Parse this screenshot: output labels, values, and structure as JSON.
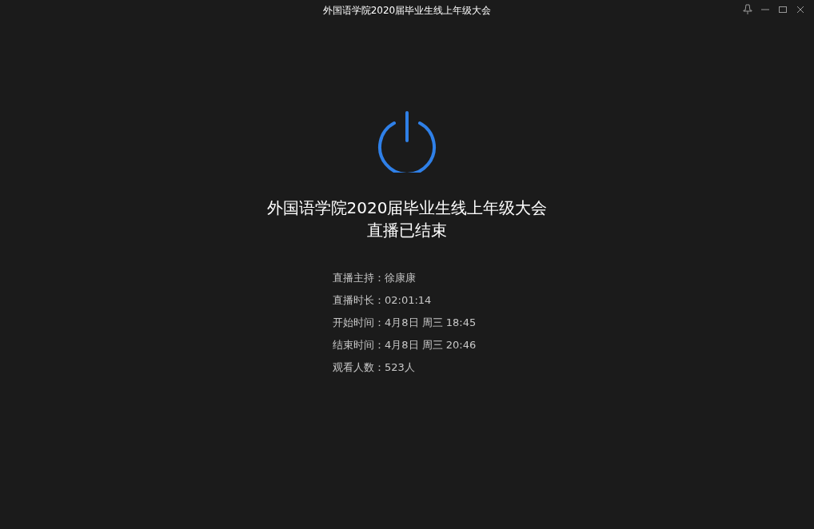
{
  "window": {
    "title": "外国语学院2020届毕业生线上年级大会"
  },
  "headline": {
    "title": "外国语学院2020届毕业生线上年级大会",
    "status": "直播已结束"
  },
  "details": [
    {
      "text": "直播主持：徐康康"
    },
    {
      "text": "直播时长：02:01:14"
    },
    {
      "text": "开始时间：4月8日 周三 18:45"
    },
    {
      "text": "结束时间：4月8日 周三 20:46"
    },
    {
      "text": "观看人数：523人"
    }
  ]
}
